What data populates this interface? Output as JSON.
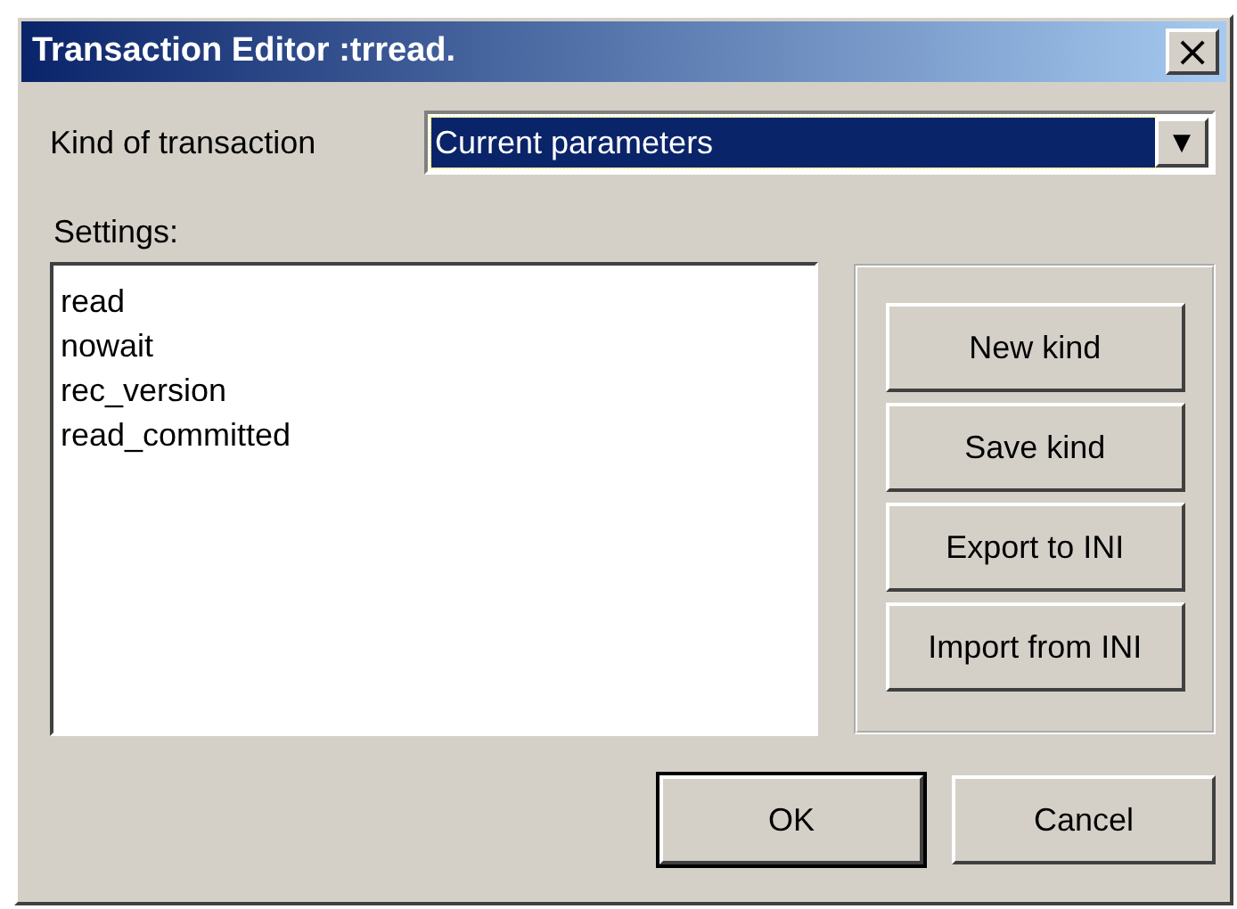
{
  "window": {
    "title": "Transaction Editor :trread.",
    "close": "×"
  },
  "kind_field": {
    "label": "Kind of transaction",
    "value": "Current parameters",
    "focused": true,
    "arrow": "▼"
  },
  "settings": {
    "label": "Settings:",
    "lines": [
      "read",
      "nowait",
      "rec_version",
      "read_committed"
    ]
  },
  "side_buttons": [
    {
      "label": "New kind"
    },
    {
      "label": "Save kind"
    },
    {
      "label": "Export to INI"
    },
    {
      "label": "Import from INI"
    }
  ],
  "dialog_buttons": [
    {
      "label": "OK",
      "default": true
    },
    {
      "label": "Cancel",
      "default": false
    }
  ]
}
